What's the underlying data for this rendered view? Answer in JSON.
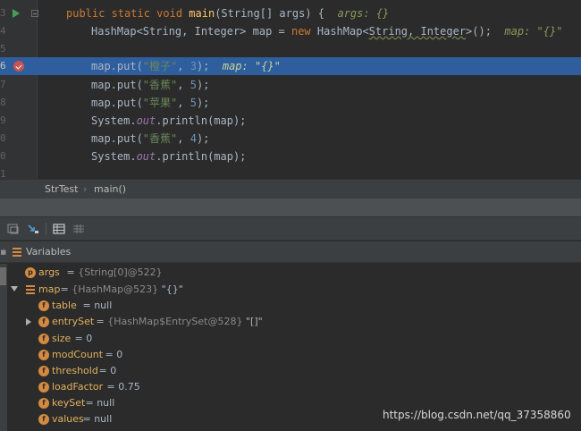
{
  "editor": {
    "lines": [
      {
        "num": "3",
        "plain": "    public static void main(String[] args) {  ",
        "hint": "args: {}"
      },
      {
        "num": "4",
        "plain": "HashMap<String, Integer> map = new HashMap<String, Integer>();  ",
        "hint": "map: \"{}\""
      },
      {
        "num": "5",
        "plain": ""
      },
      {
        "num": "6",
        "plain": "map.put(\"橙子\", 3);  ",
        "hint": "map: \"{}\""
      },
      {
        "num": "7",
        "plain": "map.put(\"香蕉\", 5);"
      },
      {
        "num": "8",
        "plain": "map.put(\"苹果\", 5);"
      },
      {
        "num": "9",
        "plain": "System.out.println(map);"
      },
      {
        "num": "0",
        "plain": "map.put(\"香蕉\", 4);"
      },
      {
        "num": "0",
        "plain": "System.out.println(map);"
      },
      {
        "num": "1",
        "plain": ""
      }
    ]
  },
  "breadcrumb": {
    "class_name": "StrTest",
    "method_name": "main()"
  },
  "variables": {
    "title": "Variables",
    "rows": [
      {
        "icon": "p",
        "name": "args",
        "value": " = ",
        "type": "{String[0]@522}",
        "extra": ""
      },
      {
        "icon": "lines",
        "name": "map",
        "value": " = ",
        "type": "{HashMap@523}",
        "extra": " \"{}\""
      },
      {
        "icon": "f",
        "name": "table",
        "value": " = null",
        "type": "",
        "extra": ""
      },
      {
        "icon": "f",
        "name": "entrySet",
        "value": " = ",
        "type": "{HashMap$EntrySet@528}",
        "extra": " \"[]\""
      },
      {
        "icon": "f",
        "name": "size",
        "value": " = 0",
        "type": "",
        "extra": ""
      },
      {
        "icon": "f",
        "name": "modCount",
        "value": " = 0",
        "type": "",
        "extra": ""
      },
      {
        "icon": "f",
        "name": "threshold",
        "value": " = 0",
        "type": "",
        "extra": ""
      },
      {
        "icon": "f",
        "name": "loadFactor",
        "value": " = 0.75",
        "type": "",
        "extra": ""
      },
      {
        "icon": "f",
        "name": "keySet",
        "value": " = null",
        "type": "",
        "extra": ""
      },
      {
        "icon": "f",
        "name": "values",
        "value": " = null",
        "type": "",
        "extra": ""
      }
    ]
  },
  "watermark": "https://blog.csdn.net/qq_37358860"
}
